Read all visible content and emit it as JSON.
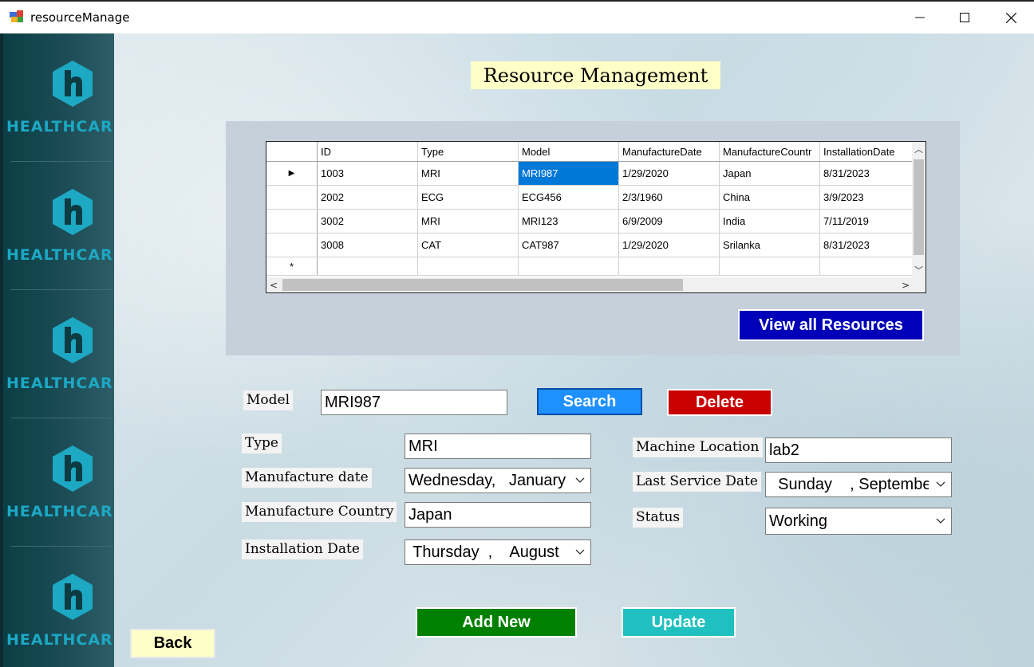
{
  "window": {
    "title": "resourceManage",
    "minimize_glyph": "—",
    "maximize_glyph": "☐",
    "close_glyph": "✕"
  },
  "sidebar": {
    "logo_text": "HEALTHCARE",
    "logo_color": "#1da8c4",
    "logos": [
      {
        "text": "HEALTHCARE"
      },
      {
        "text": "HEALTHCARE"
      },
      {
        "text": "HEALTHCARE"
      },
      {
        "text": "HEALTHCARE"
      },
      {
        "text": "HEALTHCARE"
      }
    ]
  },
  "heading": "Resource Management",
  "grid": {
    "columns": [
      "ID",
      "Type",
      "Model",
      "ManufactureDate",
      "ManufactureCountr",
      "InstallationDate"
    ],
    "rows": [
      [
        "1003",
        "MRI",
        "MRI987",
        "1/29/2020",
        "Japan",
        "8/31/2023"
      ],
      [
        "2002",
        "ECG",
        "ECG456",
        "2/3/1960",
        "China",
        "3/9/2023"
      ],
      [
        "3002",
        "MRI",
        "MRI123",
        "6/9/2009",
        "India",
        "7/11/2019"
      ],
      [
        "3008",
        "CAT",
        "CAT987",
        "1/29/2020",
        "Srilanka",
        "8/31/2023"
      ]
    ],
    "current_row_marker": "▶",
    "new_row_marker": "*",
    "selected_row": 0,
    "selected_column": 2
  },
  "buttons": {
    "view_all": "View all Resources",
    "search": "Search",
    "delete": "Delete",
    "add_new": "Add New",
    "update": "Update",
    "back": "Back"
  },
  "form": {
    "model_label": "Model",
    "model_value": "MRI987",
    "type_label": "Type",
    "type_value": "MRI",
    "manufacture_date_label": "Manufacture date",
    "manufacture_date_value": "Wednesday,   January",
    "manufacture_country_label": "Manufacture Country",
    "manufacture_country_value": "Japan",
    "installation_date_label": "Installation Date",
    "installation_date_value": " Thursday  ,    August",
    "machine_location_label": "Machine Location",
    "machine_location_value": "lab2",
    "last_service_date_label": "Last Service Date",
    "last_service_date_value": "  Sunday    , Septembe",
    "status_label": "Status",
    "status_value": "Working"
  },
  "colors": {
    "view_all_bg": "#0000b8",
    "search_bg": "#1e90ff",
    "delete_bg": "#c80000",
    "add_new_bg": "#008000",
    "update_bg": "#20c0c0",
    "back_bg": "#ffffc8",
    "selection": "#0078d7"
  }
}
